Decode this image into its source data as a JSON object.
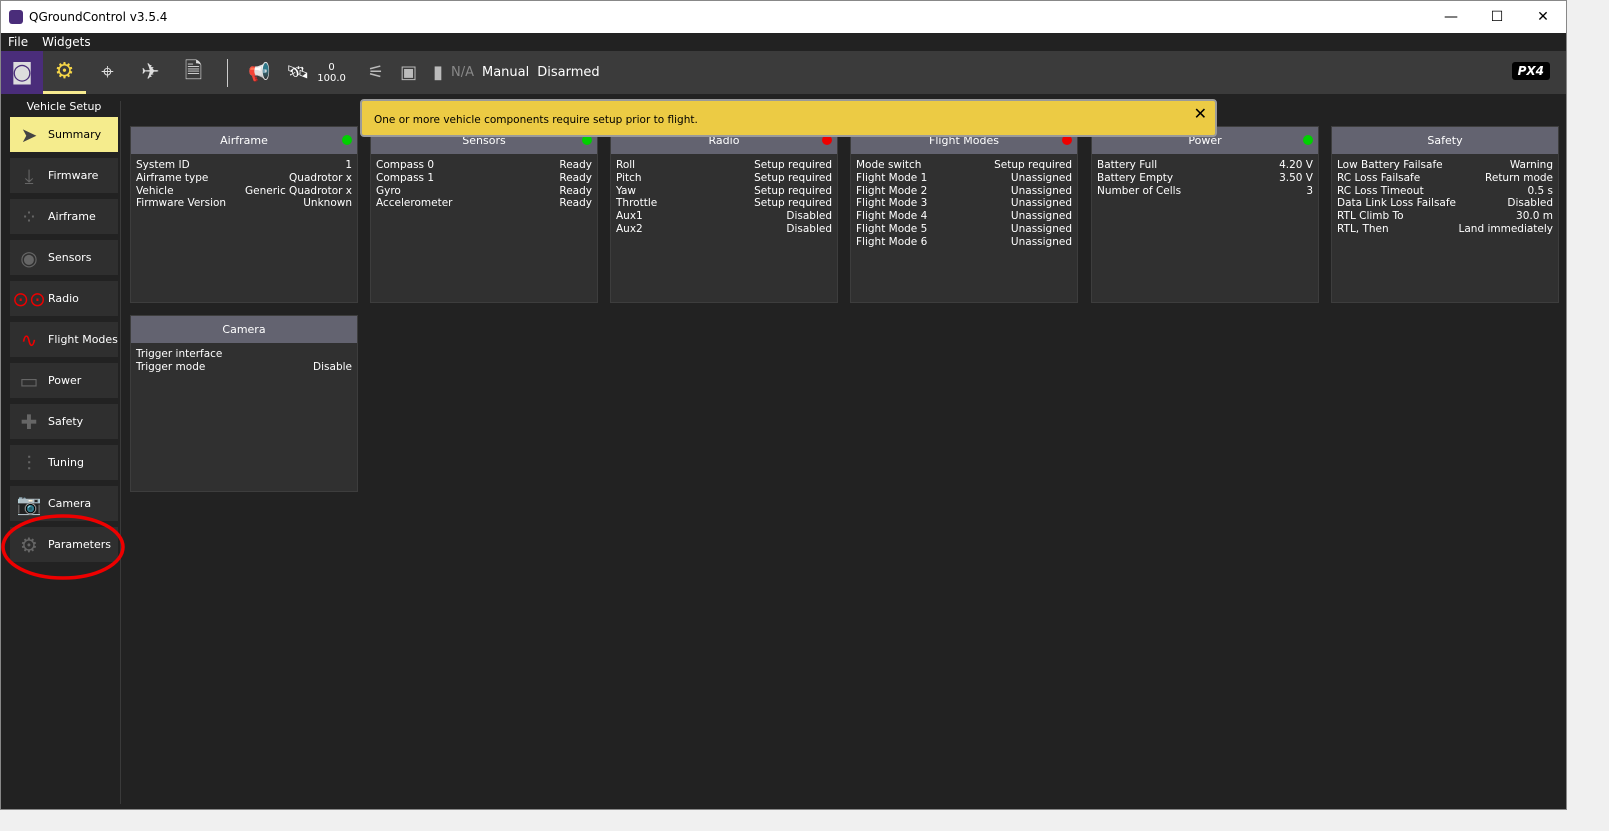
{
  "window": {
    "title": "QGroundControl v3.5.4",
    "controls": [
      "—",
      "☐",
      "✕"
    ]
  },
  "menu": [
    "File",
    "Widgets"
  ],
  "toolbar": {
    "gps_count": "0",
    "gps_hdop": "100.0",
    "battery": "N/A",
    "flight_mode": "Manual",
    "arm_state": "Disarmed",
    "logo": "PX4"
  },
  "sidebar": {
    "title": "Vehicle Setup",
    "items": [
      {
        "label": "Summary",
        "icon": "paper-plane-icon"
      },
      {
        "label": "Firmware",
        "icon": "download-icon"
      },
      {
        "label": "Airframe",
        "icon": "airframe-icon"
      },
      {
        "label": "Sensors",
        "icon": "sensors-icon"
      },
      {
        "label": "Radio",
        "icon": "radio-icon"
      },
      {
        "label": "Flight Modes",
        "icon": "flight-modes-icon"
      },
      {
        "label": "Power",
        "icon": "power-icon"
      },
      {
        "label": "Safety",
        "icon": "safety-icon"
      },
      {
        "label": "Tuning",
        "icon": "tuning-icon"
      },
      {
        "label": "Camera",
        "icon": "camera-icon"
      },
      {
        "label": "Parameters",
        "icon": "gears-icon"
      }
    ]
  },
  "banner": {
    "text": "One or more vehicle components require setup prior to flight.",
    "close": "✕"
  },
  "colors": {
    "ok": "#00d000",
    "error": "#ee0000",
    "banner": "#eccb44",
    "active": "#f5ec8d",
    "accent": "#4a2d7a"
  },
  "cards": [
    {
      "title": "Airframe",
      "status": "ok",
      "rows": [
        [
          "System ID",
          "1"
        ],
        [
          "Airframe type",
          "Quadrotor x"
        ],
        [
          "Vehicle",
          "Generic Quadrotor x"
        ],
        [
          "Firmware Version",
          "Unknown"
        ]
      ]
    },
    {
      "title": "Sensors",
      "status": "ok",
      "rows": [
        [
          "Compass 0",
          "Ready"
        ],
        [
          "Compass 1",
          "Ready"
        ],
        [
          "Gyro",
          "Ready"
        ],
        [
          "Accelerometer",
          "Ready"
        ]
      ]
    },
    {
      "title": "Radio",
      "status": "error",
      "rows": [
        [
          "Roll",
          "Setup required"
        ],
        [
          "Pitch",
          "Setup required"
        ],
        [
          "Yaw",
          "Setup required"
        ],
        [
          "Throttle",
          "Setup required"
        ],
        [
          "Aux1",
          "Disabled"
        ],
        [
          "Aux2",
          "Disabled"
        ]
      ]
    },
    {
      "title": "Flight Modes",
      "status": "error",
      "rows": [
        [
          "Mode switch",
          "Setup required"
        ],
        [
          "Flight Mode 1",
          "Unassigned"
        ],
        [
          "Flight Mode 2",
          "Unassigned"
        ],
        [
          "Flight Mode 3",
          "Unassigned"
        ],
        [
          "Flight Mode 4",
          "Unassigned"
        ],
        [
          "Flight Mode 5",
          "Unassigned"
        ],
        [
          "Flight Mode 6",
          "Unassigned"
        ]
      ]
    },
    {
      "title": "Power",
      "status": "ok",
      "rows": [
        [
          "Battery Full",
          "4.20 V"
        ],
        [
          "Battery Empty",
          "3.50 V"
        ],
        [
          "Number of Cells",
          "3"
        ]
      ]
    },
    {
      "title": "Safety",
      "status": "",
      "rows": [
        [
          "Low Battery Failsafe",
          "Warning"
        ],
        [
          "RC Loss Failsafe",
          "Return mode"
        ],
        [
          "RC Loss Timeout",
          "0.5 s"
        ],
        [
          "Data Link Loss Failsafe",
          "Disabled"
        ],
        [
          "RTL Climb To",
          "30.0 m"
        ],
        [
          "RTL, Then",
          "Land immediately"
        ]
      ]
    },
    {
      "title": "Camera",
      "status": "",
      "rows": [
        [
          "Trigger interface",
          ""
        ],
        [
          "Trigger mode",
          "Disable"
        ]
      ]
    }
  ]
}
